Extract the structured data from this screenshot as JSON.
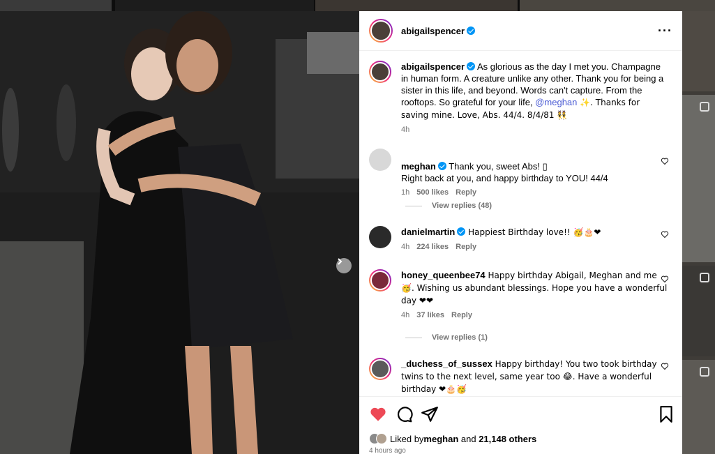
{
  "post": {
    "author": "abigailspencer",
    "more_icon": "more-horizontal-icon",
    "caption_author": "abigailspencer",
    "caption_part1": " As glorious as the day I met you. Champagne in human form. A creature unlike any other. Thank you for being a sister in this life, and beyond. Words can't capture. From the rooftops. So grateful for your life, ",
    "caption_mention": "@meghan",
    "caption_part2": " ✨. Thanks for saving mine. Love, Abs. 44/4. 8/4/81 👯",
    "caption_time": "4h"
  },
  "comments": [
    {
      "user": "meghan",
      "verified": true,
      "text": " Thank you, sweet Abs! ▯\nRight back at you, and happy birthday to YOU! 44/4",
      "time": "1h",
      "likes": "500 likes",
      "reply": "Reply",
      "view_replies": "View replies (48)"
    },
    {
      "user": "danielmartin",
      "verified": true,
      "text": " Happiest Birthday love!! 🥳🎂❤",
      "time": "4h",
      "likes": "224 likes",
      "reply": "Reply"
    },
    {
      "user": "honey_queenbee74",
      "verified": false,
      "text": " Happy birthday Abigail, Meghan and me 🥳. Wishing us abundant blessings. Hope you have a wonderful day ❤❤",
      "time": "4h",
      "likes": "37 likes",
      "reply": "Reply",
      "view_replies": "View replies (1)"
    },
    {
      "user": "_duchess_of_sussex",
      "verified": false,
      "text": " Happy birthday! You two took birthday twins to the next level, same year too 😂. Have a wonderful birthday ❤🎂🥳"
    }
  ],
  "actions": {
    "like_icon": "heart-filled-icon",
    "comment_icon": "comment-icon",
    "share_icon": "send-icon",
    "save_icon": "bookmark-icon",
    "liked_by_prefix": "Liked by ",
    "liked_by_user": "meghan",
    "liked_by_and": " and ",
    "liked_by_others": "21,148 others",
    "time_ago": "4 hours ago"
  },
  "colors": {
    "like": "#ed4956",
    "verified": "#0095f6",
    "mention": "#4a5bd4",
    "meta": "#737373"
  }
}
